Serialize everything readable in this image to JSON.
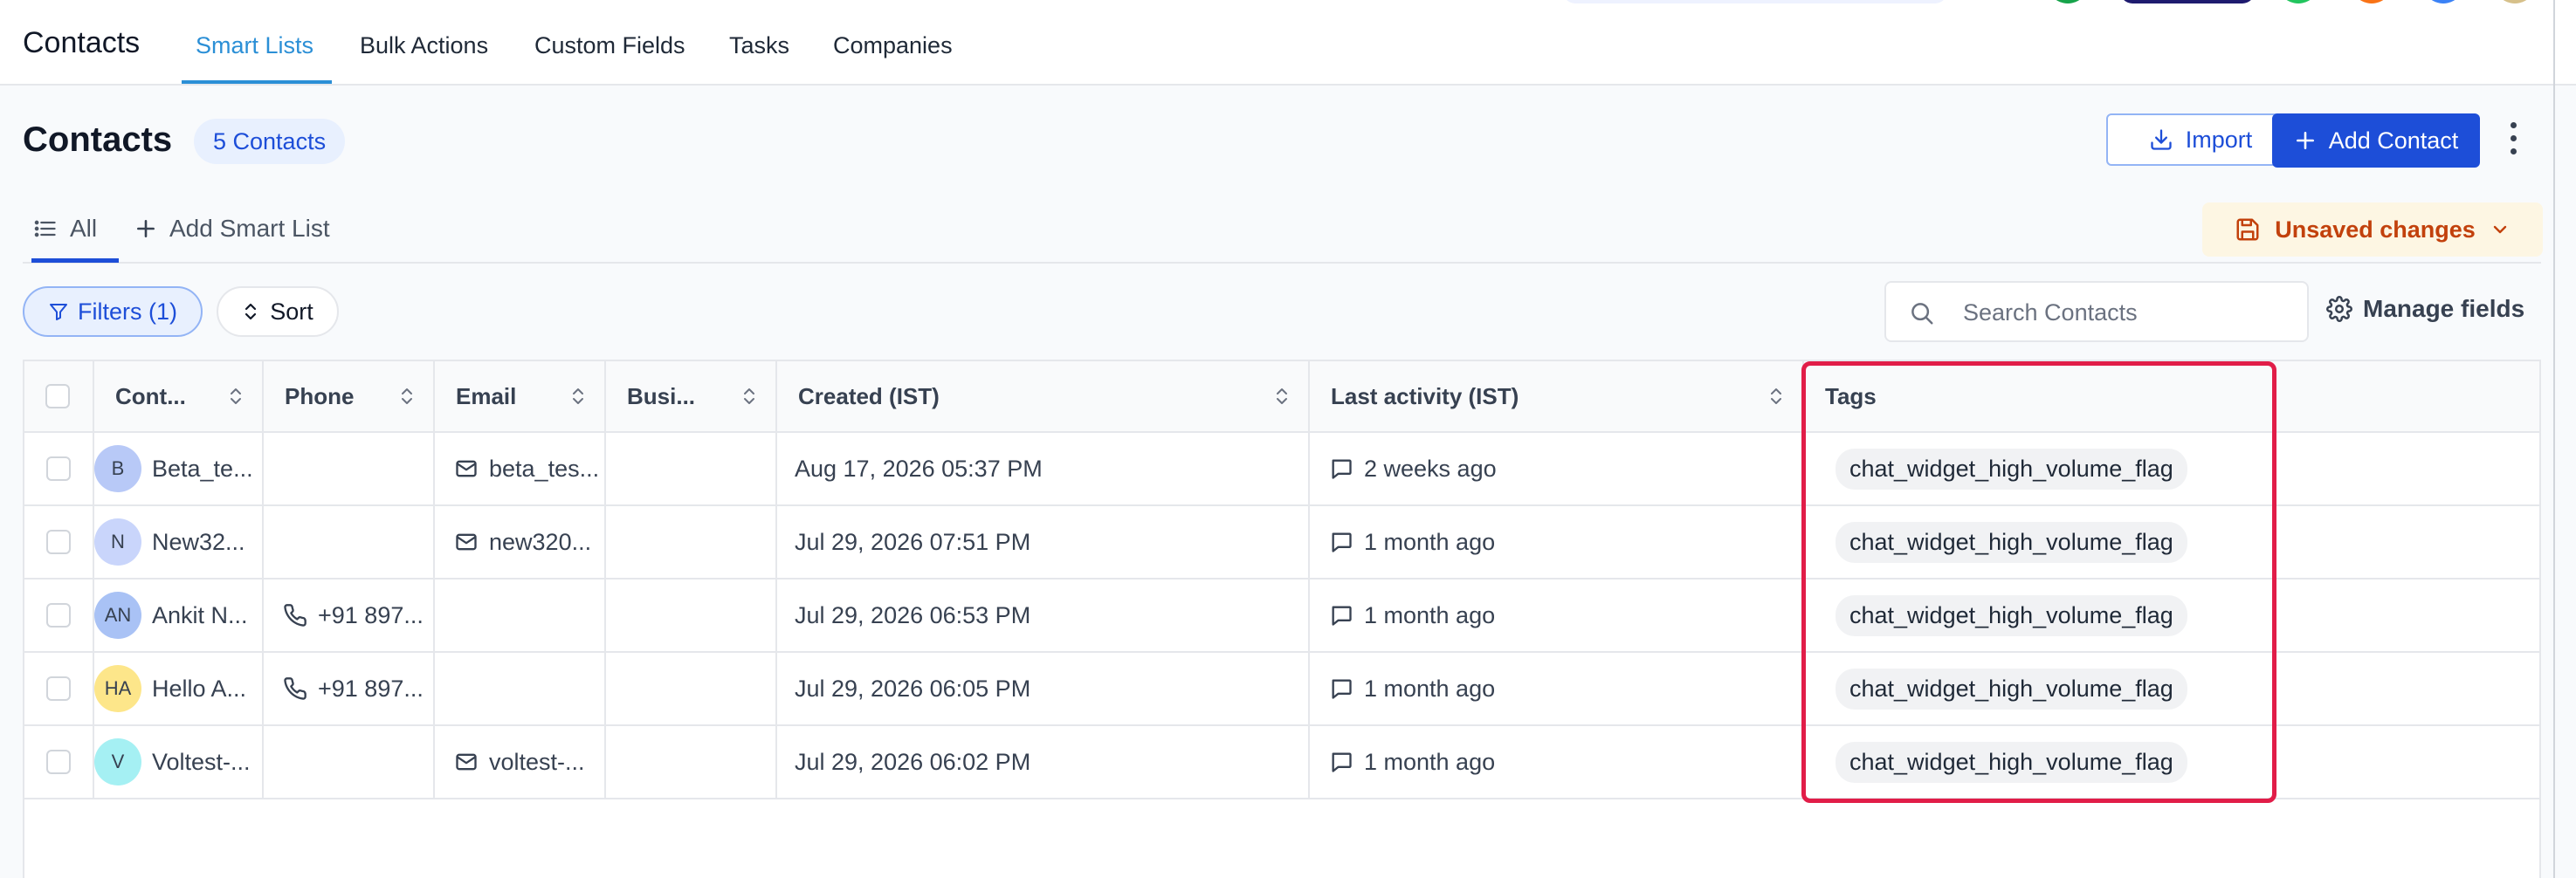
{
  "topnav": {
    "title": "Contacts",
    "tabs": [
      "Smart Lists",
      "Bulk Actions",
      "Custom Fields",
      "Tasks",
      "Companies"
    ],
    "active_tab": "Smart Lists"
  },
  "header": {
    "title": "Contacts",
    "count_badge": "5 Contacts",
    "import_label": "Import",
    "add_contact_label": "Add Contact"
  },
  "views": {
    "all_label": "All",
    "add_smart_list_label": "Add Smart List",
    "unsaved_label": "Unsaved changes"
  },
  "toolbar": {
    "filters_label": "Filters (1)",
    "sort_label": "Sort",
    "search_placeholder": "Search Contacts",
    "manage_fields_label": "Manage fields"
  },
  "table": {
    "columns": [
      "Cont...",
      "Phone",
      "Email",
      "Busi...",
      "Created (IST)",
      "Last activity (IST)",
      "Tags"
    ],
    "rows": [
      {
        "initials": "B",
        "avatar_color": "#b8c9f7",
        "name": "Beta_te...",
        "phone": "",
        "email": "beta_tes...",
        "business": "",
        "created": "Aug 17, 2026 05:37 PM",
        "last_activity": "2 weeks ago",
        "tag": "chat_widget_high_volume_flag"
      },
      {
        "initials": "N",
        "avatar_color": "#c9d5fb",
        "name": "New32...",
        "phone": "",
        "email": "new320...",
        "business": "",
        "created": "Jul 29, 2026 07:51 PM",
        "last_activity": "1 month ago",
        "tag": "chat_widget_high_volume_flag"
      },
      {
        "initials": "AN",
        "avatar_color": "#a9c2f5",
        "name": "Ankit N...",
        "phone": "+91 897...",
        "email": "",
        "business": "",
        "created": "Jul 29, 2026 06:53 PM",
        "last_activity": "1 month ago",
        "tag": "chat_widget_high_volume_flag"
      },
      {
        "initials": "HA",
        "avatar_color": "#fde68a",
        "name": "Hello A...",
        "phone": "+91 897...",
        "email": "",
        "business": "",
        "created": "Jul 29, 2026 06:05 PM",
        "last_activity": "1 month ago",
        "tag": "chat_widget_high_volume_flag"
      },
      {
        "initials": "V",
        "avatar_color": "#a5f0f3",
        "name": "Voltest-...",
        "phone": "",
        "email": "voltest-...",
        "business": "",
        "created": "Jul 29, 2026 06:02 PM",
        "last_activity": "1 month ago",
        "tag": "chat_widget_high_volume_flag"
      }
    ]
  },
  "colors": {
    "accent": "#1d4ed8",
    "nav_active": "#2b8fd6",
    "warning": "#c2410c",
    "highlight": "#e11d48"
  }
}
